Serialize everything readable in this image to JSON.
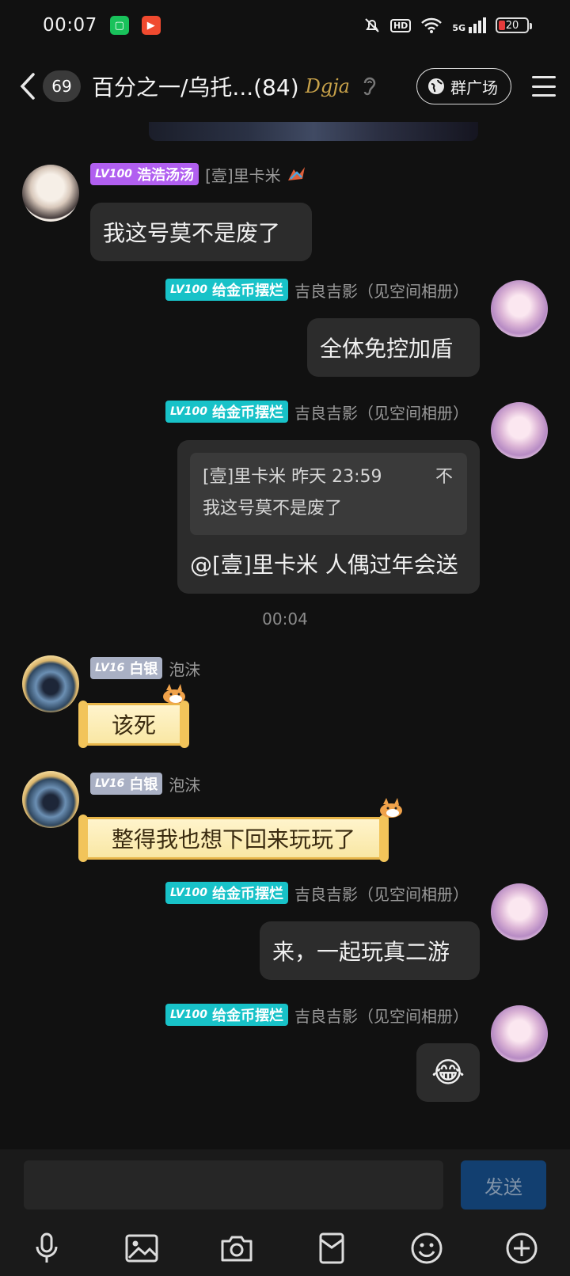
{
  "status_bar": {
    "time": "00:07",
    "hd_label": "HD",
    "network_label": "5G",
    "battery_level": "20"
  },
  "header": {
    "unread_count": "69",
    "group_title": "百分之一/乌托...(84)",
    "brand_tag": "Dgja",
    "square_button_label": "群广场"
  },
  "messages": [
    {
      "id": "m1",
      "side": "left",
      "level": "LV100",
      "title": "浩浩汤汤",
      "title_color": "#b15ff0",
      "nickname": "[壹]里卡米",
      "text": "我这号莫不是废了"
    },
    {
      "id": "m2",
      "side": "right",
      "level": "LV100",
      "title": "给金币摆烂",
      "title_color": "#18c2c8",
      "nickname": "吉良吉影（见空间相册）",
      "text": "全体免控加盾"
    },
    {
      "id": "m3",
      "side": "right",
      "level": "LV100",
      "title": "给金币摆烂",
      "title_color": "#18c2c8",
      "nickname": "吉良吉影（见空间相册）",
      "quote": {
        "header": "[壹]里卡米 昨天 23:59",
        "suffix": "不",
        "text": "我这号莫不是废了"
      },
      "text": "@[壹]里卡米 人偶过年会送"
    },
    {
      "id": "m4",
      "side": "left",
      "level": "LV16",
      "title": "白银",
      "title_color": "#a9b0c4",
      "nickname": "泡沫",
      "text": "该死"
    },
    {
      "id": "m5",
      "side": "left",
      "level": "LV16",
      "title": "白银",
      "title_color": "#a9b0c4",
      "nickname": "泡沫",
      "text": "整得我也想下回来玩玩了"
    },
    {
      "id": "m6",
      "side": "right",
      "level": "LV100",
      "title": "给金币摆烂",
      "title_color": "#18c2c8",
      "nickname": "吉良吉影（见空间相册）",
      "text": "来，一起玩真二游"
    },
    {
      "id": "m7",
      "side": "right",
      "level": "LV100",
      "title": "给金币摆烂",
      "title_color": "#18c2c8",
      "nickname": "吉良吉影（见空间相册）",
      "text": "😂"
    }
  ],
  "timestamp": "00:04",
  "input": {
    "value": "",
    "send_label": "发送"
  },
  "toolbar": [
    "microphone-icon",
    "image-icon",
    "camera-icon",
    "red-packet-icon",
    "emoji-icon",
    "plus-icon"
  ],
  "colors": {
    "background": "#111111",
    "bubble": "#2c2c2c",
    "send_button": "#123f70"
  }
}
